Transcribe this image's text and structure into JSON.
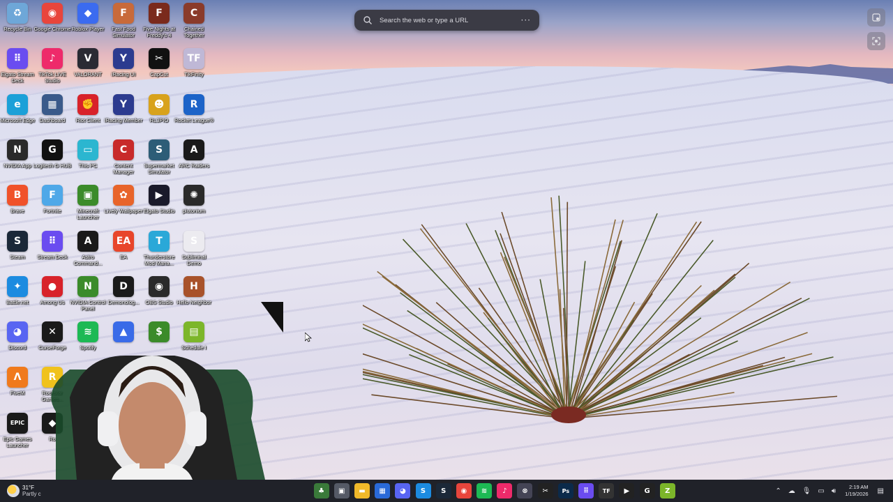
{
  "search": {
    "placeholder": "Search the web or type a URL",
    "more": "···"
  },
  "desktop_icons": [
    {
      "label": "Recycle Bin",
      "color": "#6ea7d8",
      "glyph": "♻"
    },
    {
      "label": "Google Chrome",
      "color": "#e8453c",
      "glyph": "◉"
    },
    {
      "label": "Roblox Player",
      "color": "#3b6bf0",
      "glyph": "◆"
    },
    {
      "label": "Fast Food Simulator",
      "color": "#c86a3a",
      "glyph": "F"
    },
    {
      "label": "Five Nights at Freddy's 4",
      "color": "#7a2a1c",
      "glyph": "F"
    },
    {
      "label": "Chained Together",
      "color": "#8a3b2a",
      "glyph": "C"
    },
    {
      "label": "Elgato Stream Deck",
      "color": "#6a4cf0",
      "glyph": "⠿"
    },
    {
      "label": "TikTok LIVE Studio",
      "color": "#ee2a6a",
      "glyph": "♪"
    },
    {
      "label": "VALORANT",
      "color": "#2a2a33",
      "glyph": "V"
    },
    {
      "label": "iRacing UI",
      "color": "#2c3b8f",
      "glyph": "Y"
    },
    {
      "label": "CapCut",
      "color": "#111111",
      "glyph": "✂"
    },
    {
      "label": "TikFinity",
      "color": "#bfb8d6",
      "glyph": "TF"
    },
    {
      "label": "Microsoft Edge",
      "color": "#1ba0d8",
      "glyph": "e"
    },
    {
      "label": "Dashboard",
      "color": "#3a5a8a",
      "glyph": "▦"
    },
    {
      "label": "Riot Client",
      "color": "#d8222a",
      "glyph": "✊"
    },
    {
      "label": "iRacing Member",
      "color": "#2c3b8f",
      "glyph": "Y"
    },
    {
      "label": "RL3PIO",
      "color": "#d8a21c",
      "glyph": "☻"
    },
    {
      "label": "Rocket League®",
      "color": "#1c63c8",
      "glyph": "R"
    },
    {
      "label": "NVIDIA App",
      "color": "#2a2a2a",
      "glyph": "N"
    },
    {
      "label": "Logitech G HUB",
      "color": "#111111",
      "glyph": "G"
    },
    {
      "label": "This PC",
      "color": "#2bb6d0",
      "glyph": "▭"
    },
    {
      "label": "Content Manager",
      "color": "#c82a2a",
      "glyph": "C"
    },
    {
      "label": "Supermarket Simulator",
      "color": "#2d5d77",
      "glyph": "S"
    },
    {
      "label": "ARC Raiders",
      "color": "#1a1a1a",
      "glyph": "A"
    },
    {
      "label": "Brave",
      "color": "#f0522a",
      "glyph": "B"
    },
    {
      "label": "Fortnite",
      "color": "#4fa8e8",
      "glyph": "F"
    },
    {
      "label": "Minecraft Launcher",
      "color": "#3b8b2a",
      "glyph": "▣"
    },
    {
      "label": "Lively Wallpaper",
      "color": "#e8642a",
      "glyph": "✿"
    },
    {
      "label": "Elgato Studio",
      "color": "#1a1a2a",
      "glyph": "▶"
    },
    {
      "label": "plutonium",
      "color": "#2a2a2a",
      "glyph": "✺"
    },
    {
      "label": "Steam",
      "color": "#1b2838",
      "glyph": "S"
    },
    {
      "label": "Stream Deck",
      "color": "#6a4cf0",
      "glyph": "⠿"
    },
    {
      "label": "Astro Command...",
      "color": "#1a1a1a",
      "glyph": "A"
    },
    {
      "label": "EA",
      "color": "#e8452a",
      "glyph": "EA"
    },
    {
      "label": "Thunderstore Mod Mana...",
      "color": "#2aa8d8",
      "glyph": "T"
    },
    {
      "label": "Subliminal Demo",
      "color": "#ecebf0",
      "glyph": "S"
    },
    {
      "label": "Battle.net",
      "color": "#1c8be0",
      "glyph": "✦"
    },
    {
      "label": "Among Us",
      "color": "#d8222a",
      "glyph": "●"
    },
    {
      "label": "NVIDIA Control Panel",
      "color": "#3b8b2a",
      "glyph": "N"
    },
    {
      "label": "Demonolog...",
      "color": "#1a1a1a",
      "glyph": "D"
    },
    {
      "label": "OBS Studio",
      "color": "#2a2a2a",
      "glyph": "◉"
    },
    {
      "label": "Hello Neighbor",
      "color": "#a8522a",
      "glyph": "H"
    },
    {
      "label": "Discord",
      "color": "#5865f2",
      "glyph": "◕"
    },
    {
      "label": "CurseForge",
      "color": "#1a1a1a",
      "glyph": "✕"
    },
    {
      "label": "Spotify",
      "color": "#1db954",
      "glyph": "≋"
    },
    {
      "label": "",
      "color": "#3a6be8",
      "glyph": "▲"
    },
    {
      "label": "",
      "color": "#3b8b2a",
      "glyph": "$"
    },
    {
      "label": "Schedule I",
      "color": "#7cb62a",
      "glyph": "▤"
    },
    {
      "label": "FiveM",
      "color": "#f07a1c",
      "glyph": "Λ"
    },
    {
      "label": "Rockstar Games...",
      "color": "#f0c21c",
      "glyph": "R"
    },
    {
      "label": "Epic Games Launcher",
      "color": "#1a1a1a",
      "glyph": "EPIC"
    },
    {
      "label": "Ro",
      "color": "#1a1a1a",
      "glyph": "◆"
    }
  ],
  "weather": {
    "temp": "31°F",
    "condition": "Partly c"
  },
  "taskbar_apps": [
    {
      "name": "widgets",
      "color": "#3a7a3a",
      "glyph": "♣"
    },
    {
      "name": "task-view",
      "color": "#555a66",
      "glyph": "▣"
    },
    {
      "name": "file-explorer",
      "color": "#f0b92a",
      "glyph": "▬"
    },
    {
      "name": "store",
      "color": "#2a6ad8",
      "glyph": "▦"
    },
    {
      "name": "discord",
      "color": "#5865f2",
      "glyph": "◕"
    },
    {
      "name": "shazam",
      "color": "#1c8be0",
      "glyph": "S"
    },
    {
      "name": "steam",
      "color": "#1b2838",
      "glyph": "S"
    },
    {
      "name": "chrome",
      "color": "#e8453c",
      "glyph": "◉"
    },
    {
      "name": "spotify",
      "color": "#1db954",
      "glyph": "≋"
    },
    {
      "name": "tiktok",
      "color": "#ee2a6a",
      "glyph": "♪"
    },
    {
      "name": "record",
      "color": "#444455",
      "glyph": "⊗"
    },
    {
      "name": "capcut",
      "color": "#222",
      "glyph": "✂"
    },
    {
      "name": "photoshop",
      "color": "#0b2a4a",
      "glyph": "Ps"
    },
    {
      "name": "stream-deck",
      "color": "#6a4cf0",
      "glyph": "⠿"
    },
    {
      "name": "tikfinity",
      "color": "#333",
      "glyph": "TF"
    },
    {
      "name": "elgato",
      "color": "#222",
      "glyph": "▶"
    },
    {
      "name": "ghub",
      "color": "#222",
      "glyph": "G"
    },
    {
      "name": "app-green",
      "color": "#7cb62a",
      "glyph": "Z"
    }
  ],
  "clock": {
    "time": "2:19 AM",
    "date": "1/19/2026"
  }
}
